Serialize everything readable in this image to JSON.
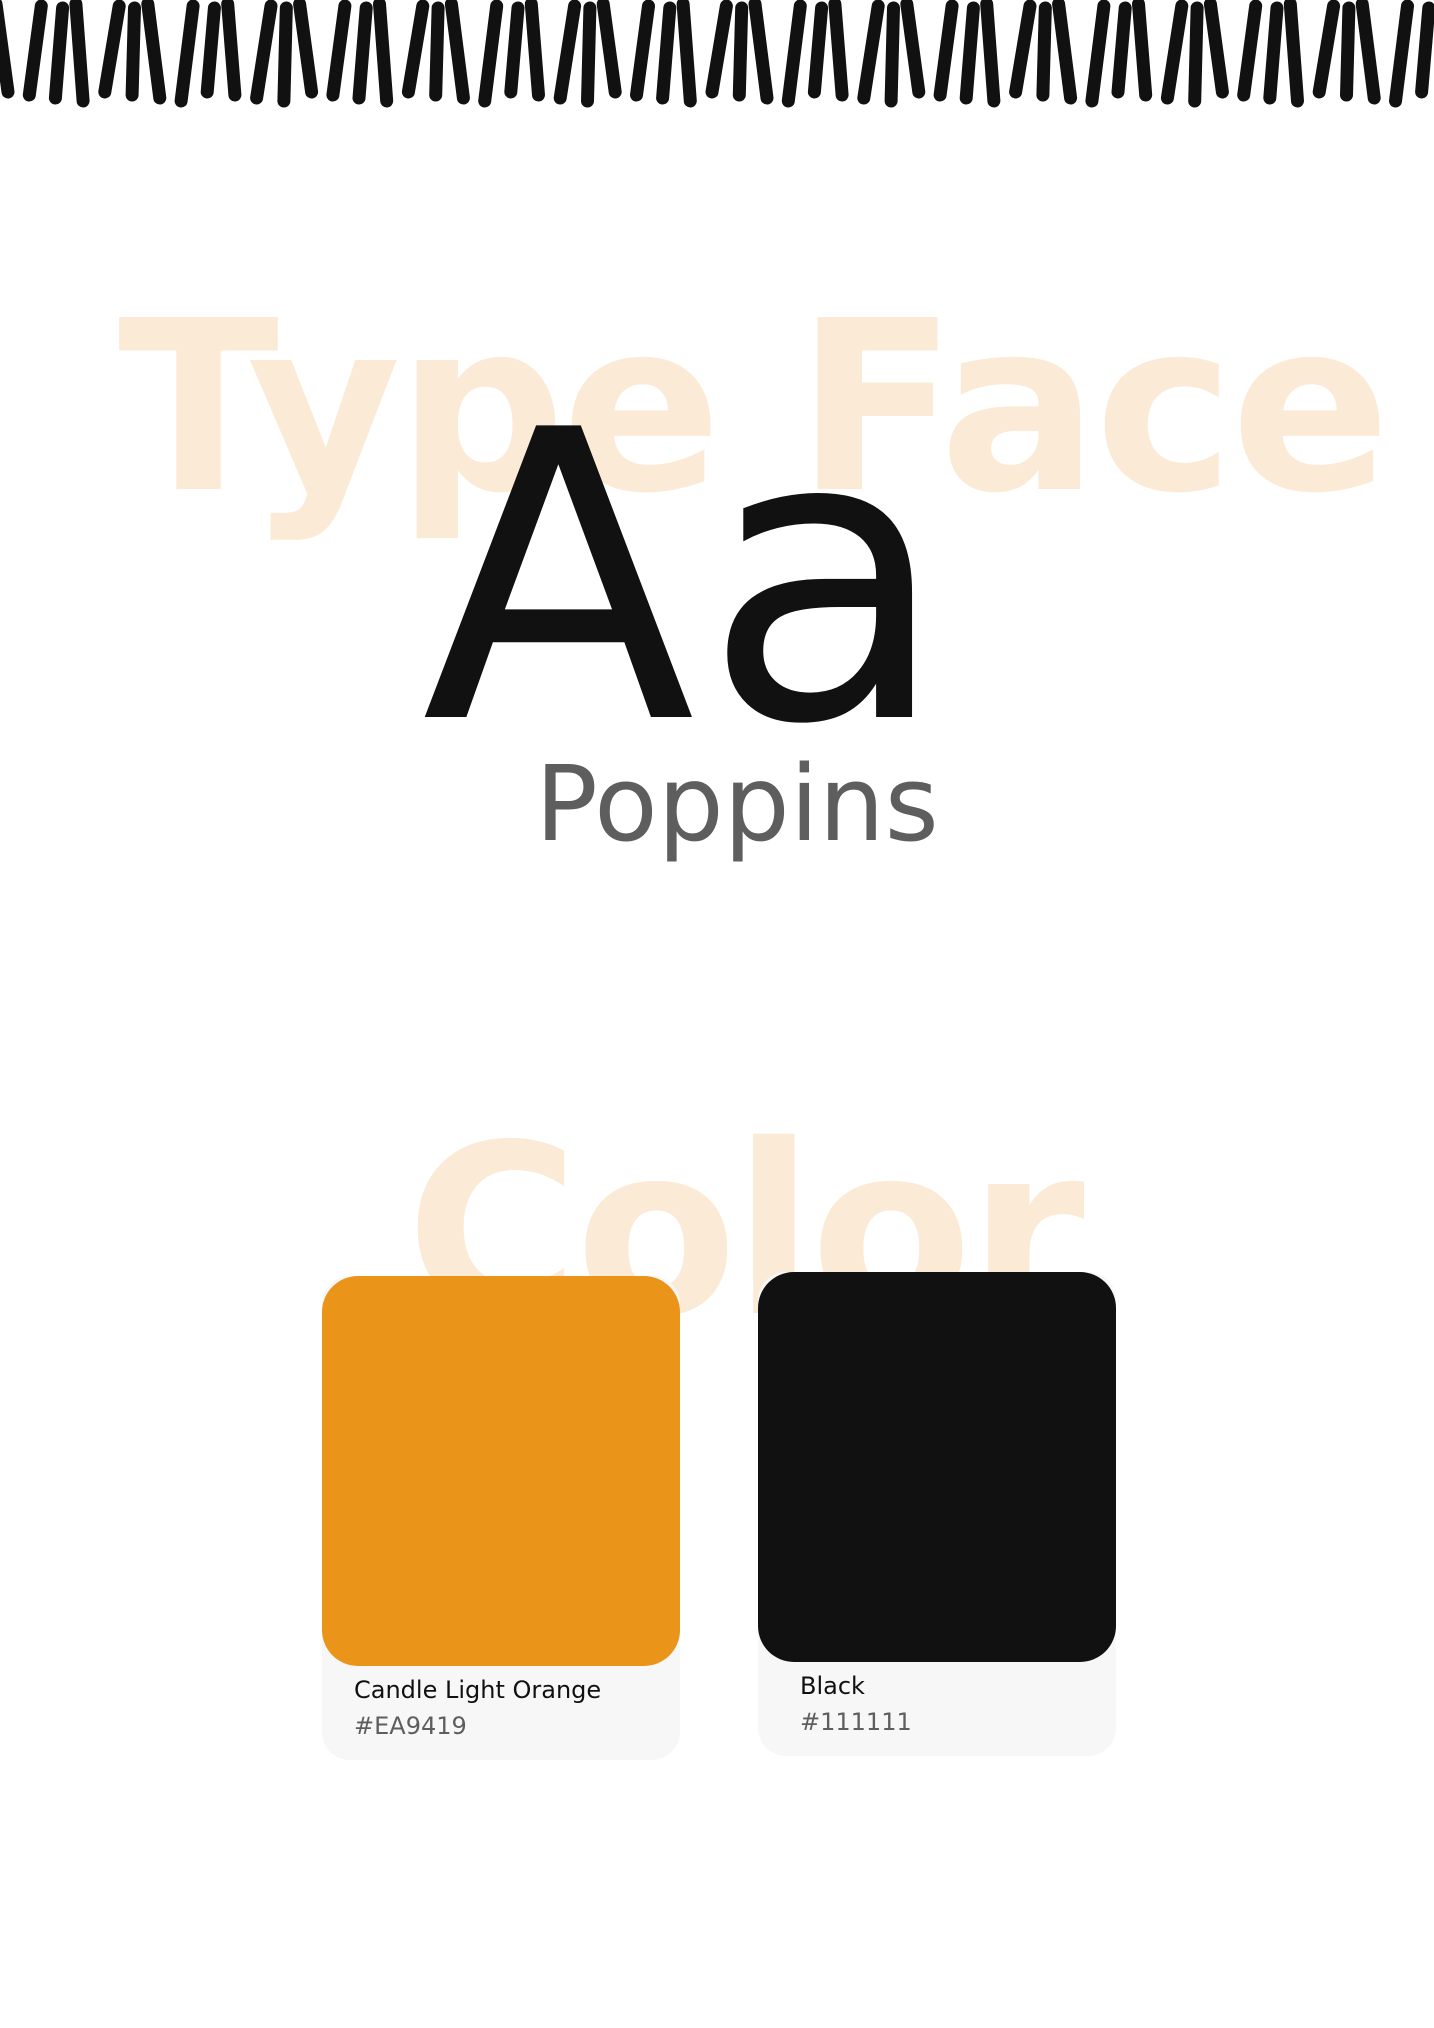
{
  "typeface_section": {
    "heading": "Type Face",
    "specimen": "Aa",
    "font_name": "Poppins"
  },
  "color_section": {
    "heading": "Color",
    "swatches": [
      {
        "name": "Candle Light Orange",
        "hex_label": "#EA9419",
        "color": "#EA9419"
      },
      {
        "name": "Black",
        "hex_label": "#111111",
        "color": "#111111"
      }
    ]
  },
  "colors": {
    "watermark": "#FBEAD6",
    "stripes": "#111111",
    "card_background": "#F7F7F7",
    "muted_text": "#5E5E5E"
  }
}
